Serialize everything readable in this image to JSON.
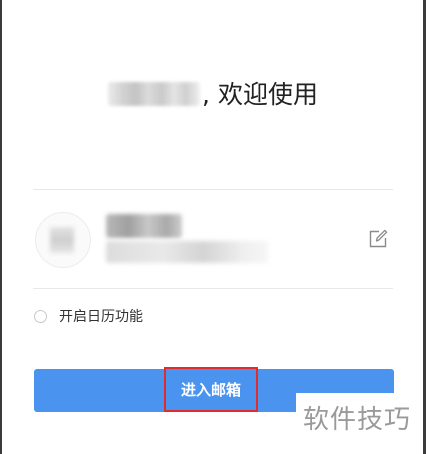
{
  "header": {
    "welcome_suffix": ", 欢迎使用"
  },
  "account": {
    "edit_icon": "edit-icon"
  },
  "options": {
    "calendar_label": "开启日历功能",
    "calendar_enabled": false
  },
  "actions": {
    "enter_label": "进入邮箱",
    "button_color": "#4a94ef",
    "highlight_color": "#e02c2c"
  },
  "watermark": {
    "text": "软件技巧"
  }
}
